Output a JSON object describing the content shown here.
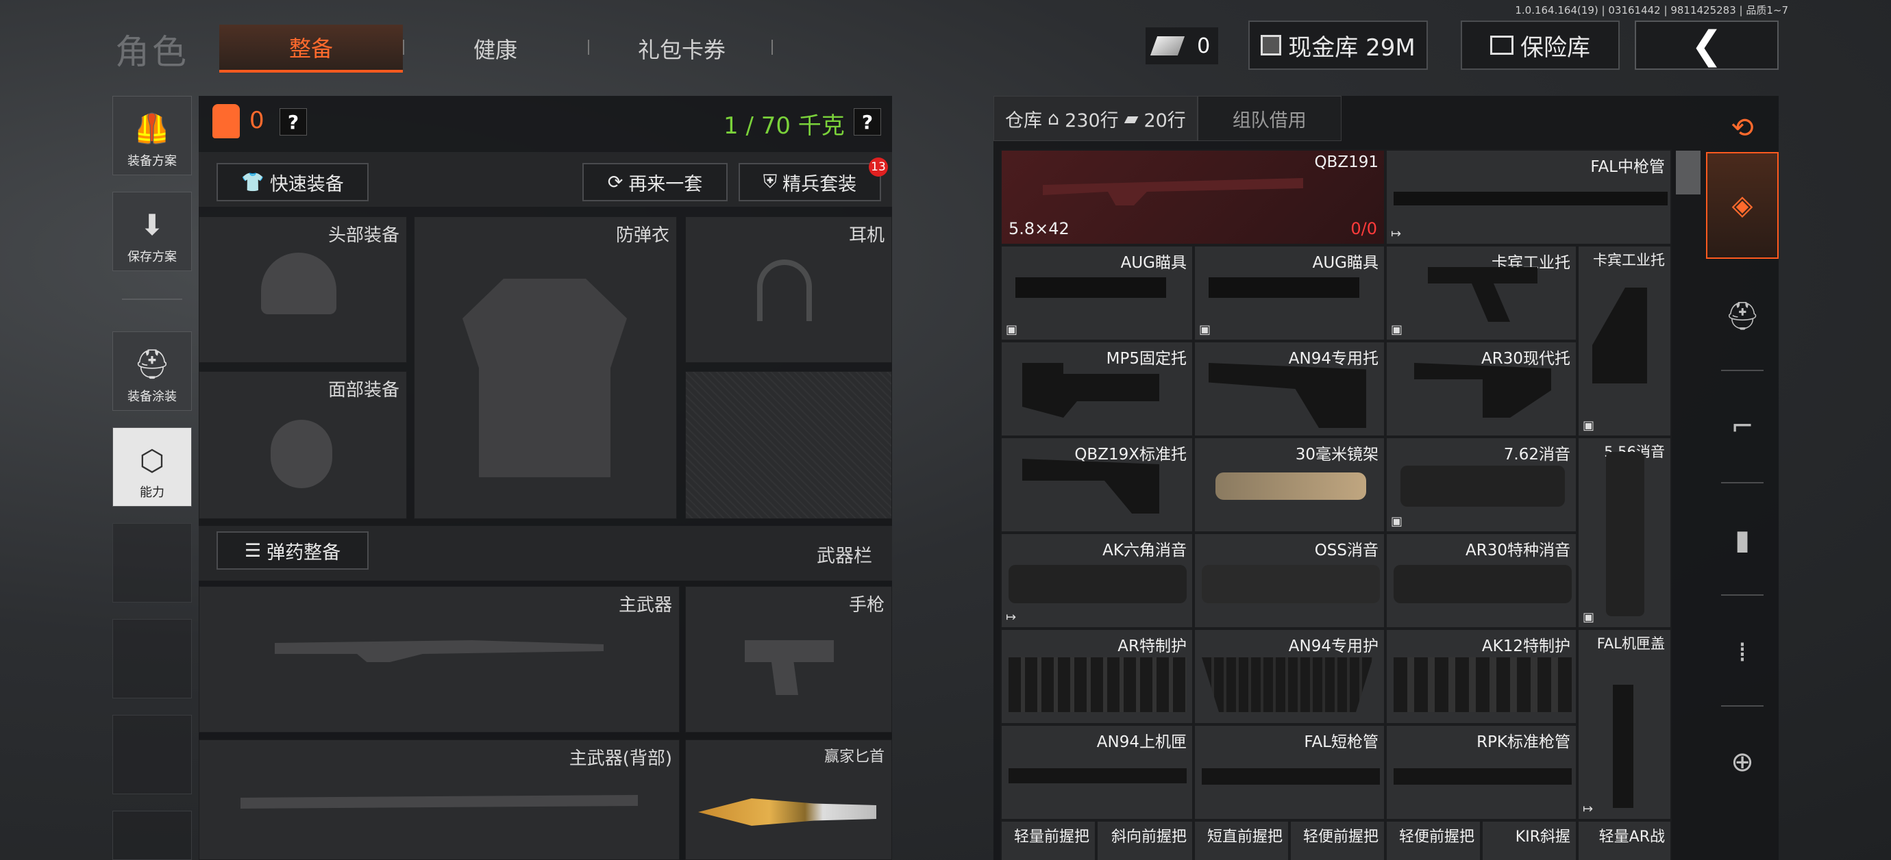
{
  "version_line": "1.0.164.164(19) | 03161442 | 9811425283 | 品质1~7",
  "header": {
    "role_title": "角色",
    "tabs": [
      {
        "label": "整备",
        "active": true
      },
      {
        "label": "健康",
        "active": false
      },
      {
        "label": "礼包卡券",
        "active": false
      }
    ],
    "cash_count": "0",
    "cash_vault_label": "现金库 29M",
    "safe_label": "保险库",
    "back_icon": "chevron-left-icon"
  },
  "sidebar": {
    "items": [
      {
        "label": "装备方案",
        "icon": "vest-icon",
        "active": false
      },
      {
        "label": "保存方案",
        "icon": "download-icon",
        "active": false
      },
      {
        "label": "装备涂装",
        "icon": "helmet-paint-icon",
        "active": false
      },
      {
        "label": "能力",
        "icon": "lightning-hex-icon",
        "active": true
      }
    ]
  },
  "loadout": {
    "armor_value": "0",
    "weight_text": "1 / 70 千克",
    "quick_equip_label": "快速装备",
    "redo_label": "再来一套",
    "elite_label": "精兵套装",
    "elite_badge": "13",
    "slots": {
      "head": "头部装备",
      "vest": "防弹衣",
      "ear": "耳机",
      "face": "面部装备"
    },
    "ammo_label": "弹药整备",
    "weapon_bar": "武器栏",
    "weapons": {
      "primary": "主武器",
      "pistol": "手枪",
      "primary_back": "主武器(背部)",
      "knife": "赢家匕首"
    }
  },
  "storage": {
    "tab_label": "仓库",
    "rows_a": "230行",
    "rows_b": "20行",
    "team_borrow": "组队借用",
    "items": [
      {
        "name": "QBZ191",
        "caliber": "5.8×42",
        "ammo": "0/0"
      },
      {
        "name": "FAL中枪管"
      },
      {
        "name": "AUG瞄具"
      },
      {
        "name": "AUG瞄具"
      },
      {
        "name": "卡宾工业托"
      },
      {
        "name": "卡宾工业托"
      },
      {
        "name": "MP5固定托"
      },
      {
        "name": "AN94专用托"
      },
      {
        "name": "AR30现代托"
      },
      {
        "name": "QBZ19X标准托"
      },
      {
        "name": "30毫米镜架"
      },
      {
        "name": "7.62消音"
      },
      {
        "name": "5.56消音"
      },
      {
        "name": "AK六角消音"
      },
      {
        "name": "OSS消音"
      },
      {
        "name": "AR30特种消音"
      },
      {
        "name": "AR特制护"
      },
      {
        "name": "AN94专用护"
      },
      {
        "name": "AK12特制护"
      },
      {
        "name": "FAL机匣盖"
      },
      {
        "name": "AN94上机匣"
      },
      {
        "name": "FAL短枪管"
      },
      {
        "name": "RPK标准枪管"
      },
      {
        "name": "轻量前握把"
      },
      {
        "name": "斜向前握把"
      },
      {
        "name": "短直前握把"
      },
      {
        "name": "轻便前握把"
      },
      {
        "name": "轻便前握把"
      },
      {
        "name": "KIR斜握"
      },
      {
        "name": "轻量AR战"
      }
    ]
  },
  "right_rail": [
    "stack-refresh-icon",
    "layers-icon",
    "helmet-icon",
    "rifle-icon",
    "magazine-icon",
    "bullets-icon",
    "scope-icon"
  ],
  "colors": {
    "accent": "#ff5a1f",
    "weight_green": "#7ad13a",
    "danger": "#ff3b3b"
  }
}
